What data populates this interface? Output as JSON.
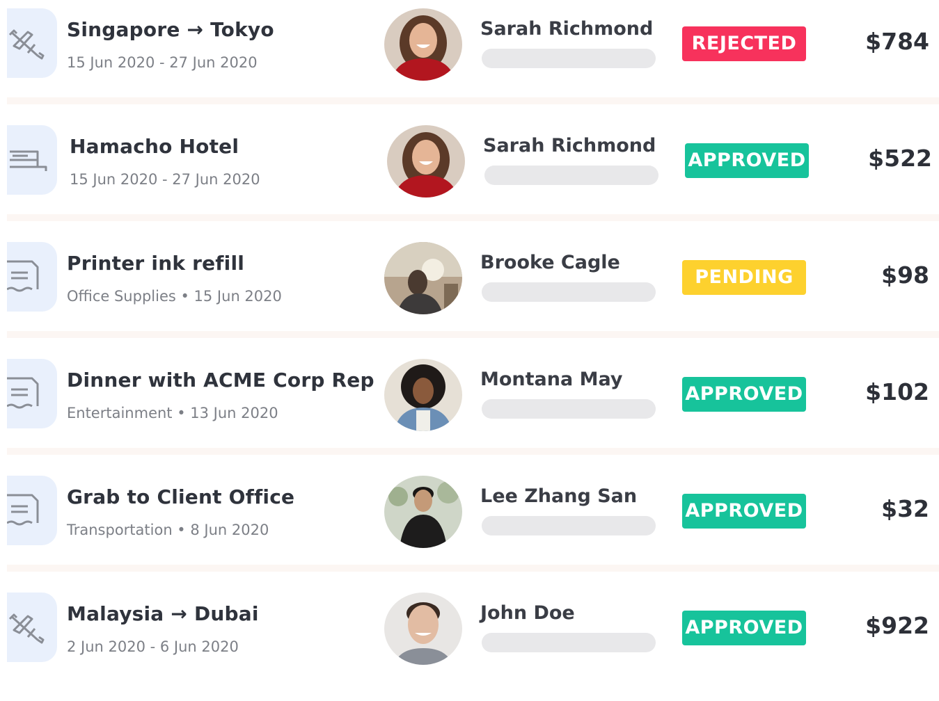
{
  "colors": {
    "rejected": "#f7325c",
    "approved": "#17c39b",
    "pending": "#fdd12e",
    "icon_bg": "#e9f0fc",
    "separator": "#fcf6f3"
  },
  "expenses": [
    {
      "icon": "plane-icon",
      "title": "Singapore → Tokyo",
      "subtitle": "15 Jun 2020 - 27 Jun 2020",
      "employee": "Sarah Richmond",
      "avatar": "sarah",
      "status": "REJECTED",
      "status_key": "rejected",
      "amount": "$784"
    },
    {
      "icon": "bed-icon",
      "title": "Hamacho Hotel",
      "subtitle": "15 Jun 2020 - 27 Jun 2020",
      "employee": "Sarah Richmond",
      "avatar": "sarah",
      "status": "APPROVED",
      "status_key": "approved",
      "amount": "$522"
    },
    {
      "icon": "receipt-icon",
      "title": "Printer ink refill",
      "subtitle": "Office Supplies • 15 Jun 2020",
      "employee": "Brooke Cagle",
      "avatar": "brooke",
      "status": "PENDING",
      "status_key": "pending",
      "amount": "$98"
    },
    {
      "icon": "receipt-icon",
      "title": "Dinner with ACME Corp Rep",
      "subtitle": "Entertainment • 13 Jun 2020",
      "employee": "Montana May",
      "avatar": "montana",
      "status": "APPROVED",
      "status_key": "approved",
      "amount": "$102"
    },
    {
      "icon": "receipt-icon",
      "title": "Grab to Client Office",
      "subtitle": "Transportation • 8 Jun 2020",
      "employee": "Lee Zhang San",
      "avatar": "lee",
      "status": "APPROVED",
      "status_key": "approved",
      "amount": "$32"
    },
    {
      "icon": "plane-icon",
      "title": "Malaysia → Dubai",
      "subtitle": "2 Jun 2020 - 6 Jun 2020",
      "employee": "John Doe",
      "avatar": "john",
      "status": "APPROVED",
      "status_key": "approved",
      "amount": "$922"
    }
  ]
}
